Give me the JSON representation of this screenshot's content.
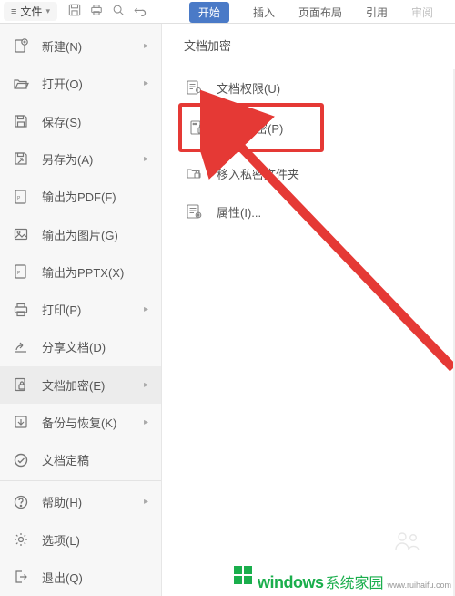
{
  "topBar": {
    "fileBtn": "文件",
    "tabs": {
      "start": "开始",
      "insert": "插入",
      "pageLayout": "页面布局",
      "reference": "引用",
      "review": "审阅"
    }
  },
  "leftMenu": {
    "new": "新建(N)",
    "open": "打开(O)",
    "save": "保存(S)",
    "saveAs": "另存为(A)",
    "exportPdf": "输出为PDF(F)",
    "exportImg": "输出为图片(G)",
    "exportPptx": "输出为PPTX(X)",
    "print": "打印(P)",
    "share": "分享文档(D)",
    "encrypt": "文档加密(E)",
    "backup": "备份与恢复(K)",
    "finalize": "文档定稿",
    "help": "帮助(H)",
    "options": "选项(L)",
    "exit": "退出(Q)"
  },
  "rightPanel": {
    "title": "文档加密",
    "perm": "文档权限(U)",
    "pwd": "密码加密(P)",
    "private": "移入私密文件夹",
    "props": "属性(I)..."
  },
  "watermark": {
    "main": "windows",
    "sub": "系统家园",
    "url": "www.ruihaifu.com"
  }
}
